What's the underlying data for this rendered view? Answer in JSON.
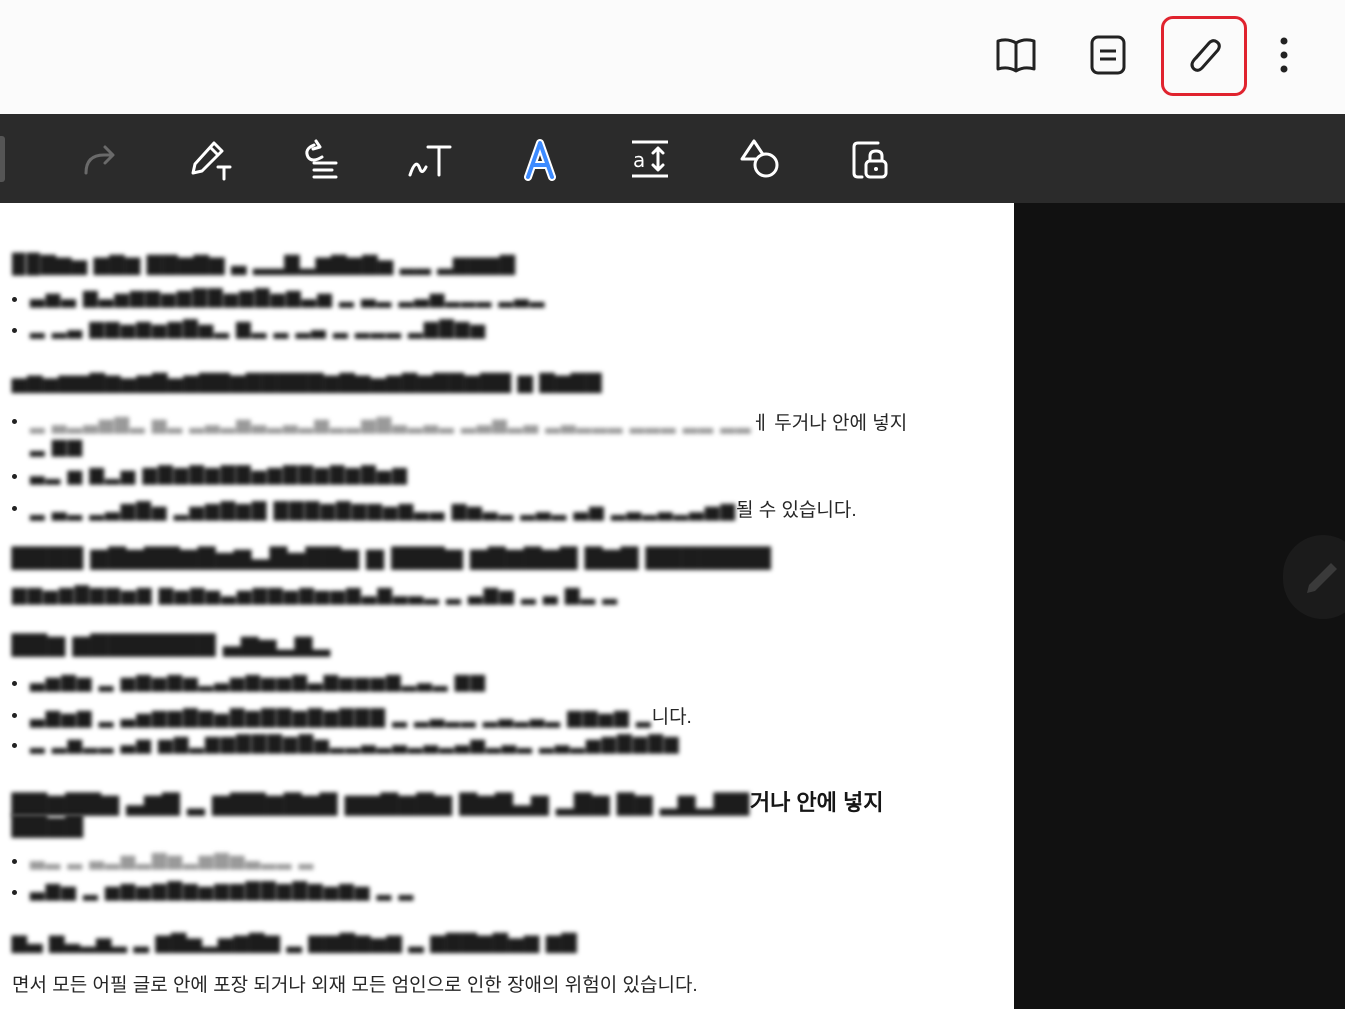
{
  "topbar": {
    "icons": [
      "book-icon",
      "note-icon",
      "paperclip-icon",
      "more-vert-icon"
    ]
  },
  "toolbar": {
    "icons": [
      "redo-icon",
      "pen-text-icon",
      "text-align-icon",
      "handwriting-icon",
      "text-style-a-icon",
      "text-spacing-icon",
      "shapes-icon",
      "lock-icon"
    ]
  },
  "document": {
    "heading1_visible": "",
    "bullets1": [
      "",
      ""
    ],
    "heading2_visible": "",
    "bullets2": [
      "ㅔ 두거나 안에 넣지",
      "",
      "될 수 있습니다."
    ],
    "heading3_visible": "",
    "line3_visible": "",
    "heading4_visible": "",
    "bullets4": [
      "",
      "니다.",
      ""
    ],
    "heading5_visible": "거나 안에 넣지",
    "bullets5": [
      "",
      ""
    ],
    "heading6_visible": "",
    "last_line": "면서 모든 어필 글로 안에 포장 되거나 외재 모든 엄인으로 인한 장애의 위험이 있습니다."
  },
  "colors": {
    "toolbar_bg": "#2b2b2b",
    "highlight_border": "#e0232e",
    "accent_blue": "#3d8bff"
  }
}
